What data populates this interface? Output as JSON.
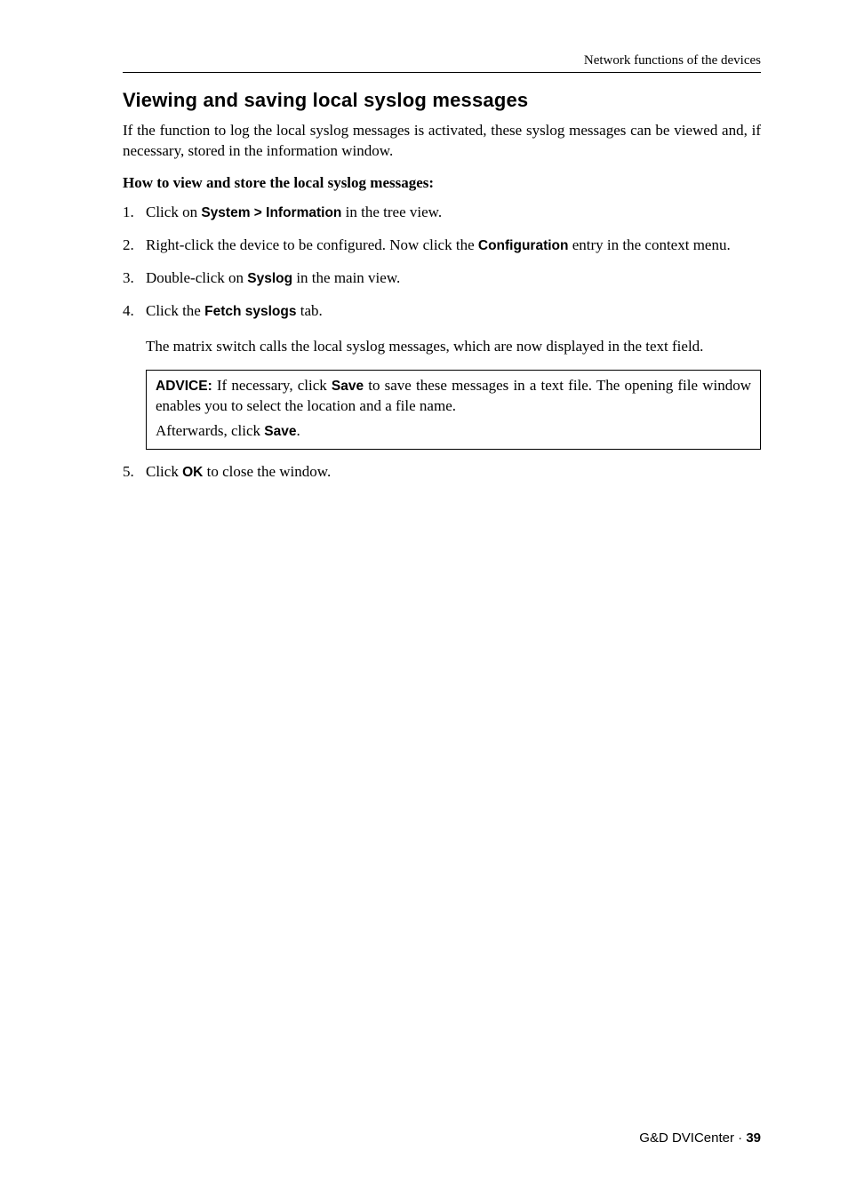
{
  "running_head": "Network functions of the devices",
  "section_title": "Viewing and saving local syslog messages",
  "intro": "If the function to log the local syslog messages is activated, these syslog messages can be viewed and, if necessary, stored in the information window.",
  "howto_heading": "How to view and store the local syslog messages:",
  "steps": {
    "s1_a": "Click on ",
    "s1_ui": "System > Information",
    "s1_b": " in the tree view.",
    "s2_a": "Right-click the device to be configured. Now click the ",
    "s2_ui": "Configuration",
    "s2_b": " entry in the context menu.",
    "s3_a": "Double-click on ",
    "s3_ui": "Syslog",
    "s3_b": " in the main view.",
    "s4_a": "Click the ",
    "s4_ui": "Fetch syslogs",
    "s4_b": " tab.",
    "s4_result": "The matrix switch calls the local syslog messages, which are now displayed in the text field.",
    "s5_a": "Click ",
    "s5_ui": "OK",
    "s5_b": " to close the window."
  },
  "advice": {
    "label": "ADVICE:",
    "p1_a": " If necessary, click ",
    "p1_ui": "Save",
    "p1_b": " to save these messages in a text file. The opening file window enables you to select the location and a file name.",
    "p2_a": "Afterwards, click ",
    "p2_ui": "Save",
    "p2_b": "."
  },
  "footer": {
    "product": "G&D DVICenter · ",
    "page": "39"
  }
}
